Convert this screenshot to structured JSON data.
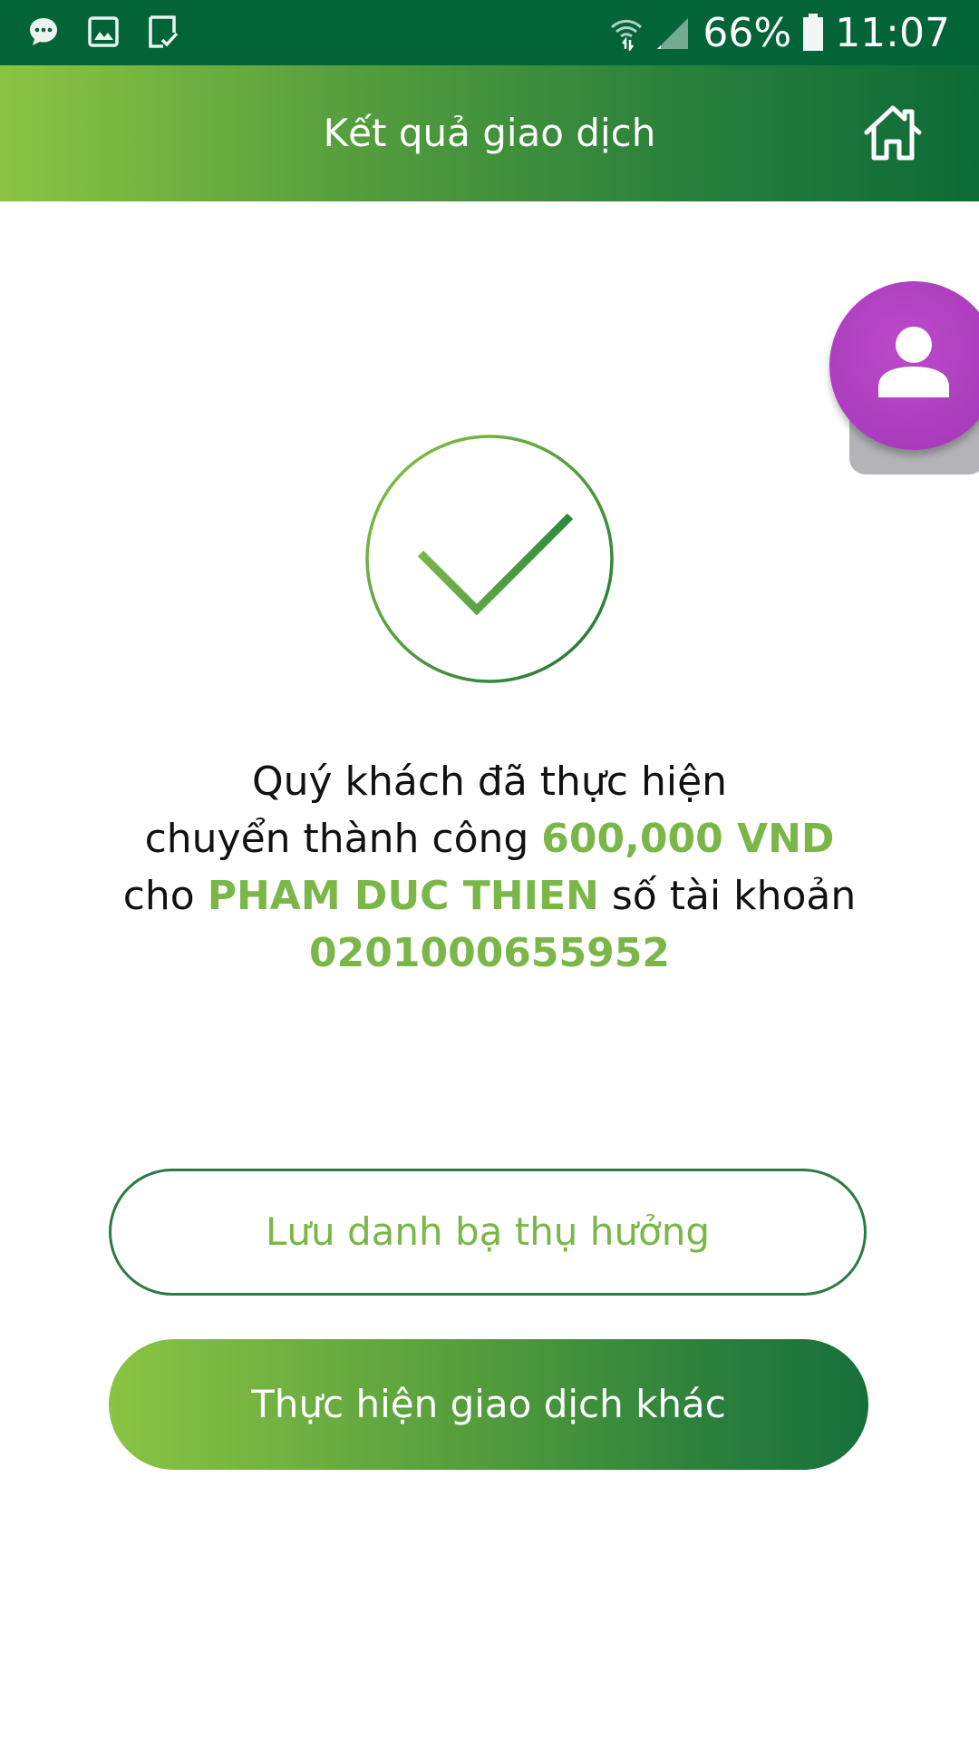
{
  "status_bar": {
    "battery": "66%",
    "time": "11:07",
    "icons": [
      "message-icon",
      "image-icon",
      "task-icon",
      "wifi-icon",
      "signal-icon",
      "battery-icon"
    ]
  },
  "header": {
    "title": "Kết quả giao dịch",
    "home_icon": "home-icon"
  },
  "floating_button": {
    "icon": "user-icon",
    "color": "#aa3dbd"
  },
  "success": {
    "icon": "check-icon"
  },
  "message": {
    "line1": "Quý khách đã thực hiện",
    "line2_prefix": "chuyển thành công ",
    "amount": "600,000 VND",
    "line3_prefix": "cho ",
    "recipient": "PHAM DUC THIEN",
    "line3_suffix": " số tài khoản",
    "account_number": "0201000655952"
  },
  "buttons": {
    "save_contact": "Lưu danh bạ thụ hưởng",
    "other_transaction": "Thực hiện giao dịch khác"
  },
  "colors": {
    "status_bar": "#036437",
    "accent_green": "#7ab648",
    "dark_green": "#0d6b36"
  }
}
